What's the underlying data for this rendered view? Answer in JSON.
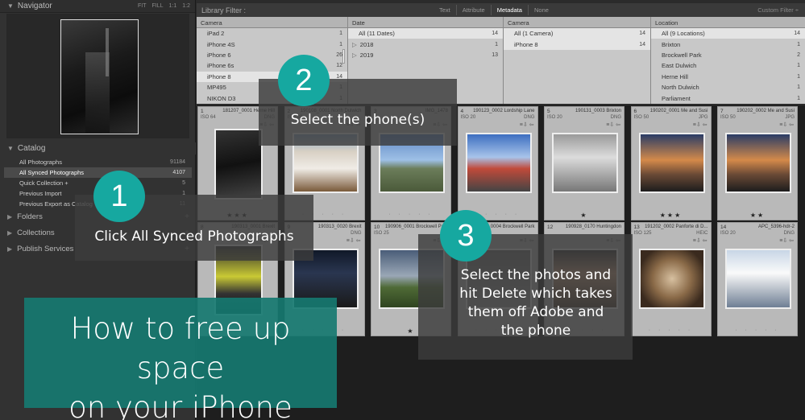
{
  "navigator": {
    "title": "Navigator",
    "zoom_options": [
      "FIT",
      "FILL",
      "1:1",
      "1:2"
    ]
  },
  "catalog": {
    "title": "Catalog",
    "items": [
      {
        "label": "All Photographs",
        "count": "91184"
      },
      {
        "label": "All Synced Photographs",
        "count": "4107"
      },
      {
        "label": "Quick Collection +",
        "count": "5"
      },
      {
        "label": "Previous Import",
        "count": "1"
      },
      {
        "label": "Previous Export as Catalog",
        "count": "11"
      }
    ]
  },
  "left_sections": [
    {
      "label": "Folders"
    },
    {
      "label": "Collections"
    },
    {
      "label": "Publish Services"
    }
  ],
  "library_filter": {
    "title": "Library Filter :",
    "tabs": [
      "Text",
      "Attribute",
      "Metadata",
      "None"
    ],
    "active_tab": "Metadata",
    "custom": "Custom Filter"
  },
  "metadata_columns": [
    {
      "header": "Camera",
      "rows": [
        {
          "label": "iPad 2",
          "count": "1"
        },
        {
          "label": "iPhone 4S",
          "count": "1"
        },
        {
          "label": "iPhone 6",
          "count": "26"
        },
        {
          "label": "iPhone 6s",
          "count": "12"
        },
        {
          "label": "iPhone 8",
          "count": "14"
        },
        {
          "label": "MP495",
          "count": "1"
        },
        {
          "label": "NIKON D3",
          "count": "1"
        }
      ]
    },
    {
      "header": "Date",
      "rows": [
        {
          "label": "All (11 Dates)",
          "count": "14"
        },
        {
          "label": "2018",
          "count": "1"
        },
        {
          "label": "2019",
          "count": "13"
        }
      ]
    },
    {
      "header": "Camera",
      "rows": [
        {
          "label": "All (1 Camera)",
          "count": "14"
        },
        {
          "label": "iPhone 8",
          "count": "14"
        }
      ]
    },
    {
      "header": "Location",
      "rows": [
        {
          "label": "All (9 Locations)",
          "count": "14"
        },
        {
          "label": "Brixton",
          "count": "1"
        },
        {
          "label": "Brockwell Park",
          "count": "2"
        },
        {
          "label": "East Dulwich",
          "count": "1"
        },
        {
          "label": "Herne Hill",
          "count": "1"
        },
        {
          "label": "North Dulwich",
          "count": "1"
        },
        {
          "label": "Parliament",
          "count": "1"
        }
      ]
    }
  ],
  "photos": [
    {
      "num": "1",
      "name": "181207_0001 Herne Hill",
      "iso": "ISO 64",
      "ext": "DNG",
      "stars": "★★★",
      "thumb": "t-night",
      "portrait": true
    },
    {
      "num": "2",
      "name": "190108_0001 North Dulwich",
      "iso": "ISO 20",
      "ext": "",
      "stars": "",
      "thumb": "t-house",
      "portrait": false
    },
    {
      "num": "3",
      "name": "IMG_1478",
      "iso": "",
      "ext": "",
      "stars": "",
      "thumb": "t-view",
      "portrait": false
    },
    {
      "num": "4",
      "name": "190123_0002 Lordship Lane",
      "iso": "ISO 20",
      "ext": "DNG",
      "stars": "",
      "thumb": "t-street",
      "portrait": false
    },
    {
      "num": "5",
      "name": "190131_0003 Brixton",
      "iso": "ISO 20",
      "ext": "DNG",
      "stars": "★",
      "thumb": "t-bw",
      "portrait": false
    },
    {
      "num": "6",
      "name": "190202_0001 Me and Susi",
      "iso": "ISO 50",
      "ext": "JPG",
      "stars": "★★★",
      "thumb": "t-selfie",
      "portrait": false
    },
    {
      "num": "7",
      "name": "190202_0002 Me and Susi",
      "iso": "ISO 50",
      "ext": "JPG",
      "stars": "★★",
      "thumb": "t-selfie",
      "portrait": false
    },
    {
      "num": "8",
      "name": "190313_0001 Brexit",
      "iso": "",
      "ext": "",
      "stars": "",
      "thumb": "t-tube",
      "portrait": true
    },
    {
      "num": "9",
      "name": "190313_0020 Brexit",
      "iso": "",
      "ext": "DNG",
      "stars": "",
      "thumb": "t-dusk",
      "portrait": false
    },
    {
      "num": "10",
      "name": "190906_0001 Brockwell Park",
      "iso": "ISO 25",
      "ext": "",
      "stars": "★",
      "thumb": "t-field",
      "portrait": false
    },
    {
      "num": "11",
      "name": "0004 Brockwell Park",
      "iso": "",
      "ext": "",
      "stars": "",
      "thumb": "t-gray",
      "portrait": false
    },
    {
      "num": "12",
      "name": "190928_0170 Huntingdon",
      "iso": "",
      "ext": "",
      "stars": "",
      "thumb": "t-man",
      "portrait": false
    },
    {
      "num": "13",
      "name": "191202_0002 Panforte di D...",
      "iso": "ISO 125",
      "ext": "HEIC",
      "stars": "",
      "thumb": "t-cake",
      "portrait": false
    },
    {
      "num": "14",
      "name": "APC_5396-hdr-2",
      "iso": "ISO 20",
      "ext": "DNG",
      "stars": "",
      "thumb": "t-chess",
      "portrait": false
    }
  ],
  "steps": [
    {
      "number": "1",
      "text": "Click All Synced Photographs"
    },
    {
      "number": "2",
      "text": "Select the phone(s)"
    },
    {
      "number": "3",
      "text": "Select the photos and hit Delete which takes them off Adobe and the phone"
    }
  ],
  "headline": {
    "line1": "How to free up space",
    "line2": "on your iPhone"
  },
  "colors": {
    "accent_teal": "#16a8a0",
    "headline_bg": "#167870"
  }
}
